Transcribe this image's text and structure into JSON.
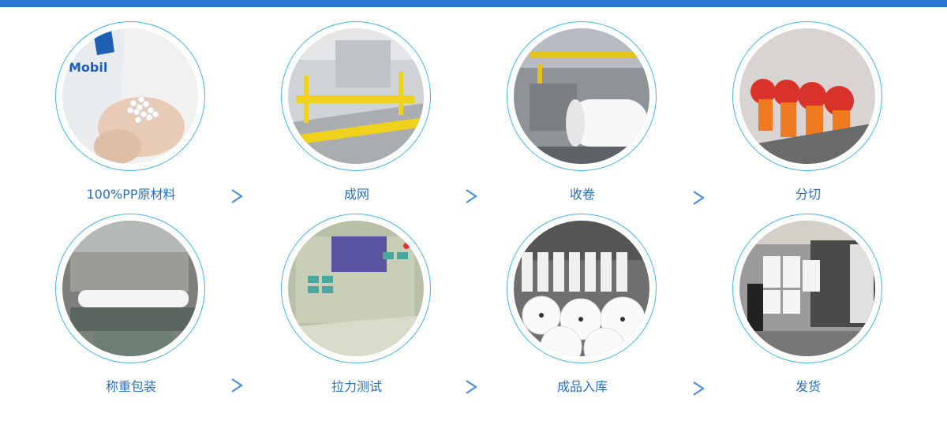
{
  "steps": [
    {
      "label": "100%PP原材料",
      "icon": "raw-material-pellets-photo",
      "logo_text": "Mobil"
    },
    {
      "label": "成网",
      "icon": "web-forming-machine-photo"
    },
    {
      "label": "收卷",
      "icon": "winding-machine-photo"
    },
    {
      "label": "分切",
      "icon": "slitting-machine-photo"
    },
    {
      "label": "称重包装",
      "icon": "weighing-packing-photo"
    },
    {
      "label": "拉力测试",
      "icon": "tensile-tester-photo"
    },
    {
      "label": "成品入库",
      "icon": "finished-rolls-warehouse-photo"
    },
    {
      "label": "发货",
      "icon": "shipping-container-photo"
    }
  ],
  "colors": {
    "accent": "#2a78d0",
    "ring": "#45b3ea",
    "label": "#2a6fbd",
    "arrow": "#4a90d9"
  }
}
